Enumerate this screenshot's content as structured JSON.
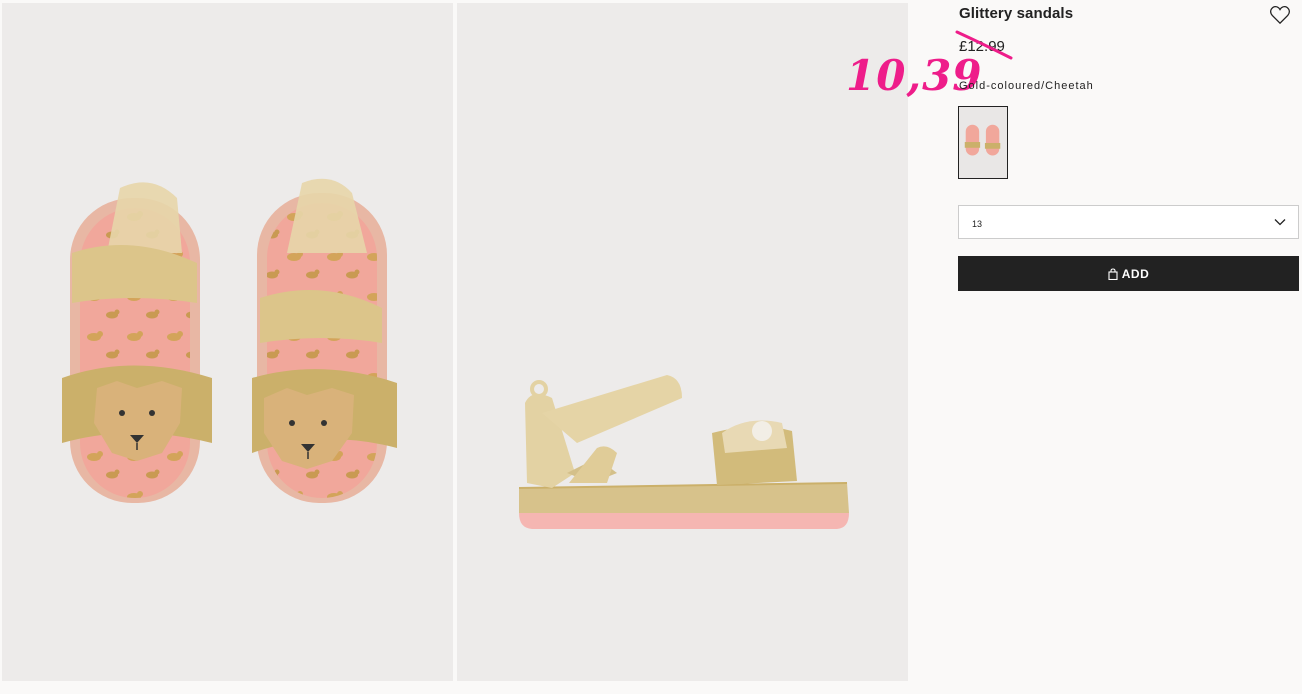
{
  "product": {
    "title": "Glittery sandals",
    "old_price": "£12.99",
    "new_price": "10,39",
    "colour_name": "Gold-coloured/Cheetah",
    "size_selected": "13",
    "add_label": "ADD"
  },
  "icons": {
    "favourite": "heart-icon",
    "dropdown": "chevron-down-icon",
    "bag": "shopping-bag-icon"
  },
  "colors": {
    "price_highlight": "#ee1d8a",
    "button_bg": "#222222",
    "image_bg": "#edebea"
  }
}
